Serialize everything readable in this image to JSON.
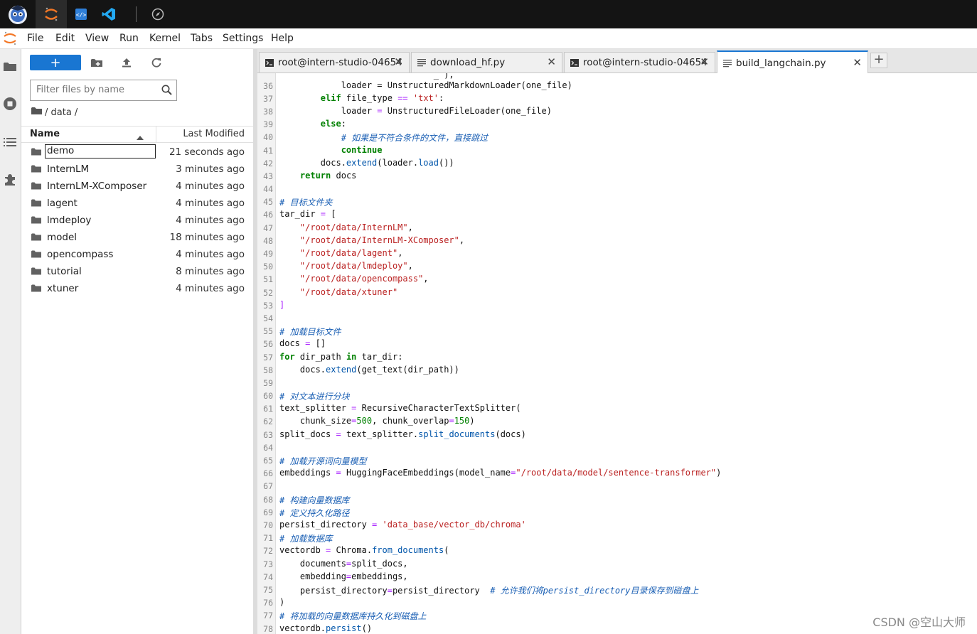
{
  "topbar": {
    "apps": [
      {
        "name": "intern-studio-logo-icon"
      },
      {
        "name": "jupyter-icon"
      },
      {
        "name": "code-editor-icon"
      },
      {
        "name": "vscode-icon"
      },
      {
        "name": "compass-icon"
      }
    ]
  },
  "menubar": {
    "items": [
      "File",
      "Edit",
      "View",
      "Run",
      "Kernel",
      "Tabs",
      "Settings",
      "Help"
    ]
  },
  "filebrowser": {
    "new_button_label": "+",
    "filter_placeholder": "Filter files by name",
    "breadcrumb": "/ data /",
    "header_name": "Name",
    "header_modified": "Last Modified",
    "files": [
      {
        "name": "demo",
        "modified": "21 seconds ago"
      },
      {
        "name": "InternLM",
        "modified": "3 minutes ago"
      },
      {
        "name": "InternLM-XComposer",
        "modified": "4 minutes ago"
      },
      {
        "name": "lagent",
        "modified": "4 minutes ago"
      },
      {
        "name": "lmdeploy",
        "modified": "4 minutes ago"
      },
      {
        "name": "model",
        "modified": "18 minutes ago"
      },
      {
        "name": "opencompass",
        "modified": "4 minutes ago"
      },
      {
        "name": "tutorial",
        "modified": "8 minutes ago"
      },
      {
        "name": "xtuner",
        "modified": "4 minutes ago"
      }
    ]
  },
  "tabs": [
    {
      "label": "root@intern-studio-04654",
      "type": "terminal"
    },
    {
      "label": "download_hf.py",
      "type": "file"
    },
    {
      "label": "root@intern-studio-04654",
      "type": "terminal"
    },
    {
      "label": "build_langchain.py",
      "type": "file",
      "active": true
    }
  ],
  "editor": {
    "line_numbers": [
      "36",
      "37",
      "38",
      "39",
      "40",
      "41",
      "42",
      "43",
      "44",
      "45",
      "46",
      "47",
      "48",
      "49",
      "50",
      "51",
      "52",
      "53",
      "54",
      "55",
      "56",
      "57",
      "58",
      "59",
      "60",
      "61",
      "62",
      "63",
      "64",
      "65",
      "66",
      "67",
      "68",
      "69",
      "70",
      "71",
      "72",
      "73",
      "74",
      "75",
      "76",
      "77",
      "78"
    ]
  },
  "watermark": "CSDN @空山大师"
}
